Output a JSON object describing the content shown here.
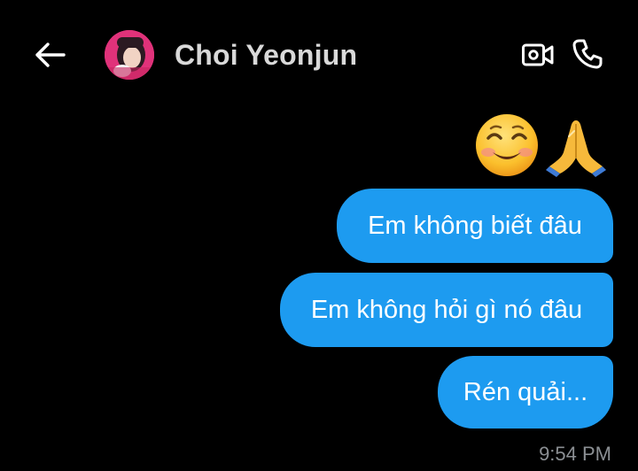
{
  "header": {
    "contact_name": "Choi Yeonjun",
    "back_icon": "arrow-left-icon",
    "video_icon": "video-call-icon",
    "phone_icon": "phone-icon"
  },
  "messages": [
    {
      "text": "Em không biết đâu"
    },
    {
      "text": "Em không hỏi gì nó đâu"
    },
    {
      "text": "Rén quải..."
    }
  ],
  "emoji_message": {
    "emojis": [
      "smiling-face-icon",
      "folded-hands-icon"
    ]
  },
  "timestamp": "9:54 PM",
  "colors": {
    "background": "#000000",
    "bubble": "#1d9bf0",
    "bubble_text": "#ffffff",
    "name": "#d9d9d9",
    "timestamp": "#8b8f93"
  }
}
